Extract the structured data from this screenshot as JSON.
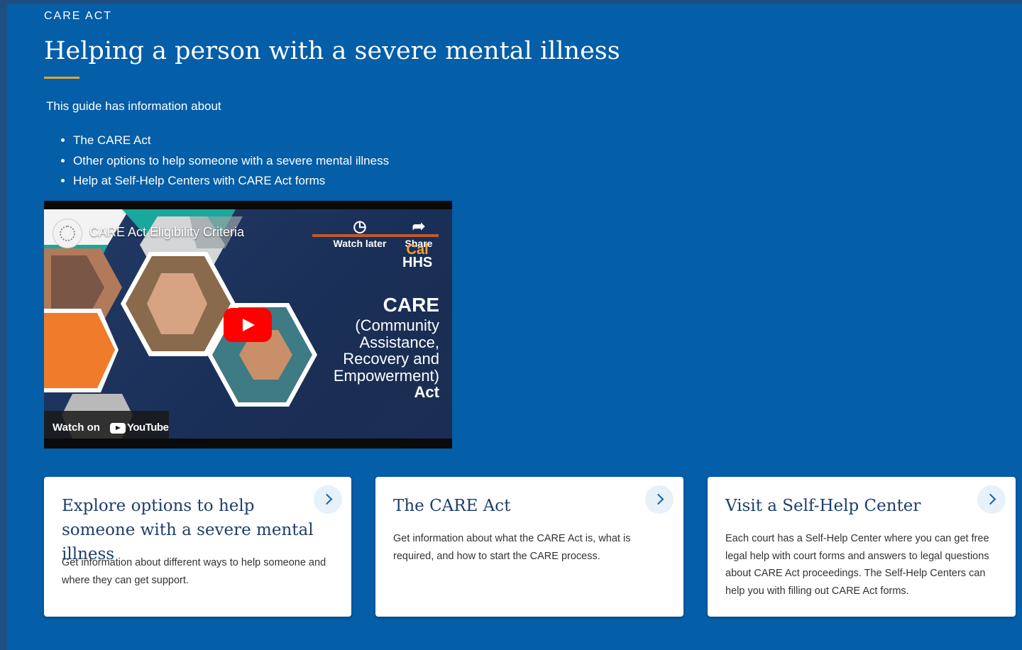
{
  "header": {
    "eyebrow": "CARE ACT",
    "title": "Helping a person with a severe mental illness"
  },
  "intro": {
    "text": "This guide has information about",
    "items": [
      "The CARE Act",
      "Other options to help someone with a severe mental illness",
      "Help at Self-Help Centers with CARE Act forms"
    ]
  },
  "video": {
    "title": "CARE Act Eligibility Criteria",
    "watch_later_label": "Watch later",
    "share_label": "Share",
    "logo_cal": "Cal",
    "logo_hhs": "HHS",
    "care_title": "CARE",
    "care_lines": [
      "(Community",
      "Assistance,",
      "Recovery and",
      "Empowerment)"
    ],
    "care_act": "Act",
    "watch_on_label": "Watch on",
    "youtube_label": "YouTube",
    "icons": {
      "watch_later": "clock-icon",
      "share": "share-arrow-icon",
      "play": "play-icon",
      "youtube": "youtube-logo-icon"
    }
  },
  "cards": [
    {
      "title": "Explore options to help someone with a severe mental illness",
      "description": "Get information about different ways to help someone and where they can get support."
    },
    {
      "title": "The CARE Act",
      "description": "Get information about what the CARE Act is, what is required, and how to start the CARE process."
    },
    {
      "title": "Visit a Self-Help Center",
      "description": "Each court has a Self-Help Center where you can get free legal help with court forms and answers to legal questions about CARE Act proceedings. The Self-Help Centers can help you with filling out CARE Act forms."
    }
  ],
  "colors": {
    "background": "#045ea8",
    "accent_rule": "#e0a52d",
    "card_title": "#1f3e6b",
    "arrow_bg": "#e6f1f9",
    "play_red": "#ff0000"
  }
}
